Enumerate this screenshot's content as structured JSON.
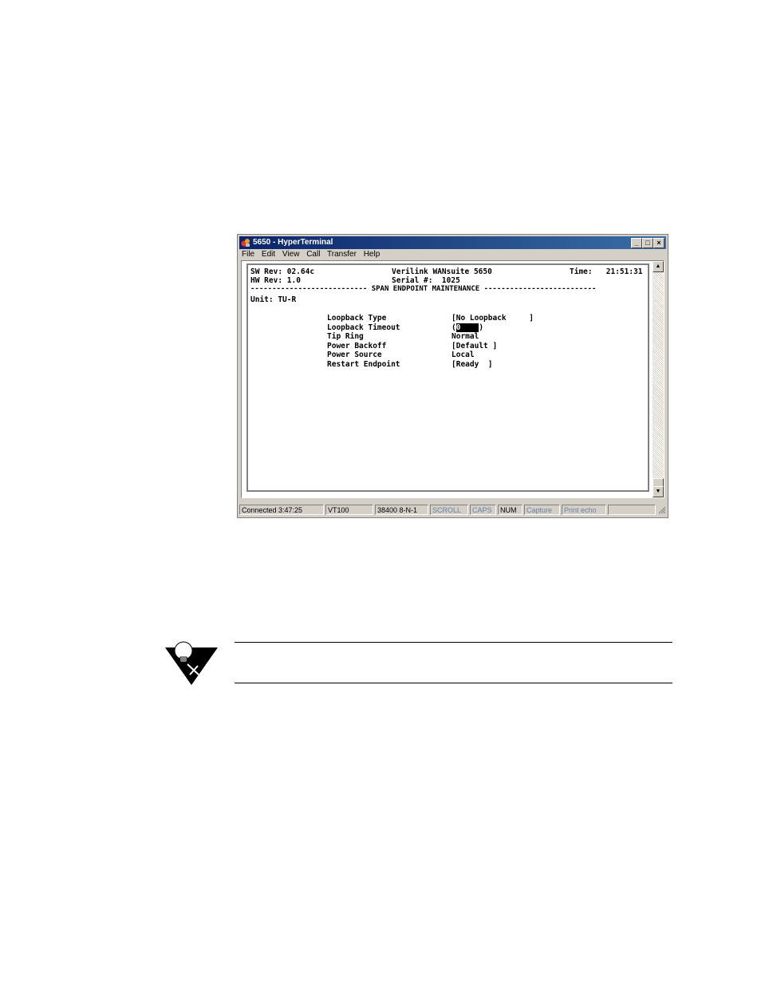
{
  "window": {
    "title": "5650 - HyperTerminal",
    "menu": [
      "File",
      "Edit",
      "View",
      "Call",
      "Transfer",
      "Help"
    ]
  },
  "terminal": {
    "sw_rev": "SW Rev: 02.64c",
    "hw_rev": "HW Rev: 1.0",
    "product": "Verilink WANsuite 5650",
    "serial": "Serial #:  1025",
    "time": "Time:   21:51:31",
    "header": "--------------------------- SPAN ENDPOINT MAINTENANCE --------------------------",
    "unit": "Unit: TU-R",
    "fields": [
      {
        "label": "Loopback Type",
        "value": "[No Loopback     ]"
      },
      {
        "label": "Loopback Timeout",
        "value_open": "(",
        "value_sel": "0    ",
        "value_close": ")"
      },
      {
        "label": "Tip Ring",
        "value": "Normal"
      },
      {
        "label": "Power Backoff",
        "value": "[Default ]"
      },
      {
        "label": "Power Source",
        "value": "Local"
      },
      {
        "label": "Restart Endpoint",
        "value": "[Ready  ]"
      }
    ]
  },
  "status": {
    "connected": "Connected 3:47:25",
    "emulation": "VT100",
    "settings": "38400 8-N-1",
    "scroll": "SCROLL",
    "caps": "CAPS",
    "num": "NUM",
    "capture": "Capture",
    "print_echo": "Print echo"
  },
  "colors": {
    "title_gradient_start": "#0a246a",
    "title_gradient_end": "#3a6ea5",
    "window_face": "#d4d0c8"
  }
}
